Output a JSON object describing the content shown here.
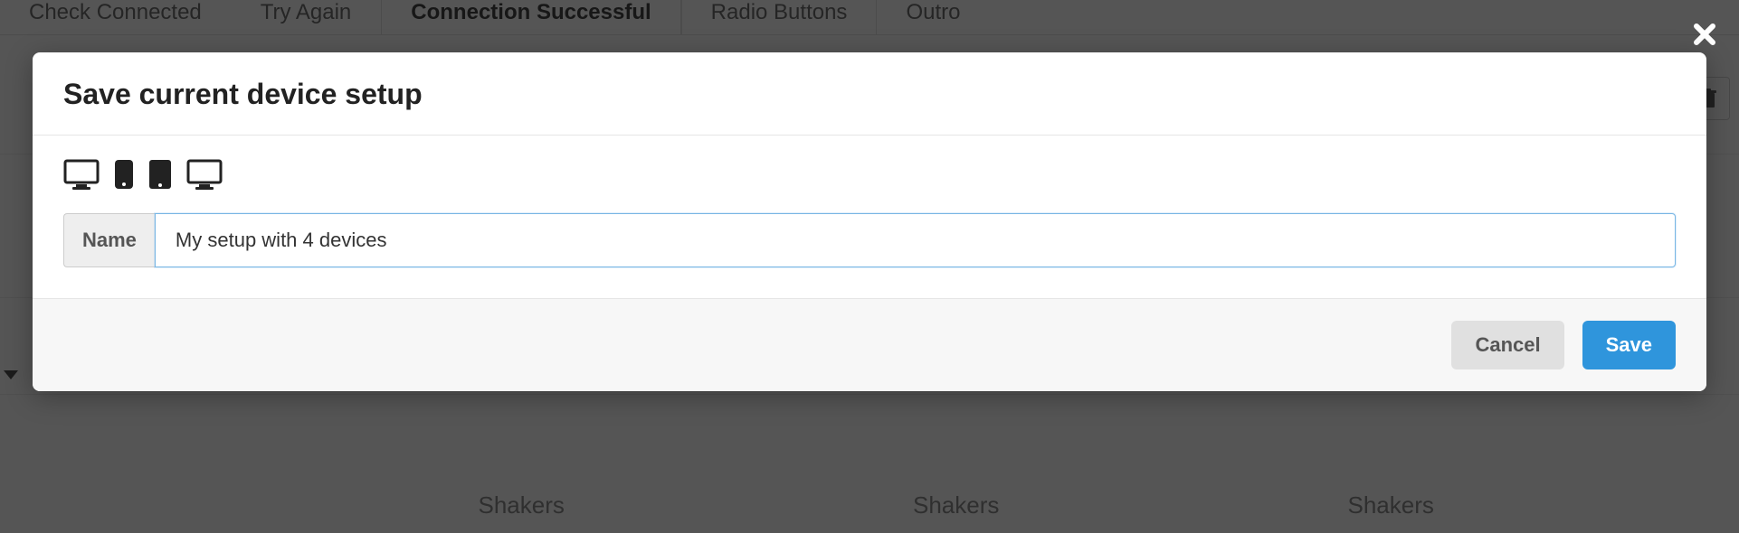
{
  "background": {
    "tabs": [
      {
        "label": "Check Connected",
        "active": false
      },
      {
        "label": "Try Again",
        "active": false
      },
      {
        "label": "Connection Successful",
        "active": true
      },
      {
        "label": "Radio Buttons",
        "active": false
      },
      {
        "label": "Outro",
        "active": false
      }
    ],
    "list_item_label": "Shakers"
  },
  "modal": {
    "title": "Save current device setup",
    "devices": [
      {
        "type": "desktop"
      },
      {
        "type": "phone"
      },
      {
        "type": "tablet"
      },
      {
        "type": "desktop"
      }
    ],
    "name_label": "Name",
    "name_value": "My setup with 4 devices",
    "cancel_label": "Cancel",
    "save_label": "Save"
  }
}
